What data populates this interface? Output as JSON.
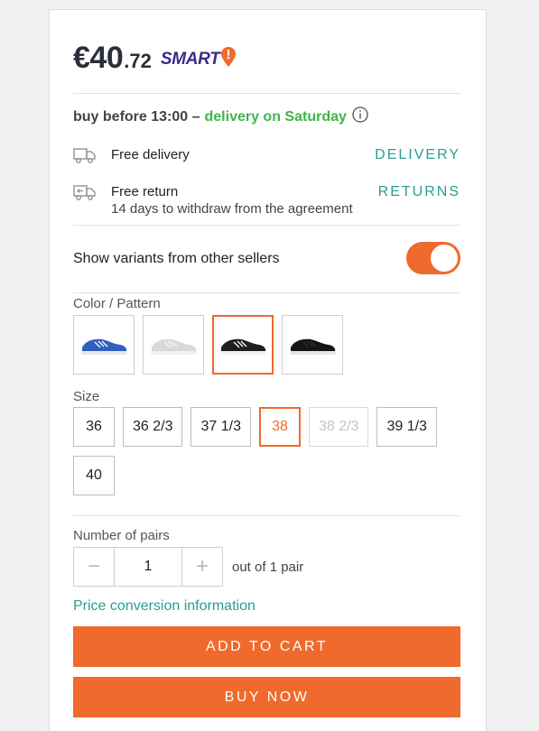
{
  "price": {
    "main": "€40",
    "decimal": ".72",
    "badge": "SMART"
  },
  "delivery": {
    "deadline_prefix": "buy before 13:00 –",
    "deadline_highlight": "delivery on Saturday",
    "info_icon": "info-icon"
  },
  "services": [
    {
      "icon": "truck-icon",
      "title": "Free delivery",
      "subtitle": "",
      "link": "DELIVERY"
    },
    {
      "icon": "return-truck-icon",
      "title": "Free return",
      "subtitle": "14 days to withdraw from the agreement",
      "link": "RETURNS"
    }
  ],
  "variants_toggle": {
    "label": "Show variants from other sellers",
    "state": "on"
  },
  "color": {
    "label": "Color / Pattern",
    "swatches": [
      {
        "name": "blue-shoe",
        "selected": false
      },
      {
        "name": "grey-shoe",
        "selected": false
      },
      {
        "name": "black-white-shoe",
        "selected": true
      },
      {
        "name": "black-shoe",
        "selected": false
      }
    ]
  },
  "size": {
    "label": "Size",
    "options": [
      "36",
      "36 2/3",
      "37 1/3",
      "38",
      "38 2/3",
      "39 1/3",
      "40"
    ],
    "selected": "38",
    "disabled": [
      "38 2/3"
    ]
  },
  "quantity": {
    "label": "Number of pairs",
    "value": "1",
    "note": "out of 1 pair",
    "minus": "−",
    "plus": "+"
  },
  "conversion_link": "Price conversion information",
  "buttons": {
    "add_to_cart": "ADD TO CART",
    "buy_now": "BUY NOW"
  },
  "colors": {
    "accent": "#ef6a2c",
    "green": "#41b44a",
    "teal": "#2a9d8f",
    "brand": "#3d2a8a"
  }
}
